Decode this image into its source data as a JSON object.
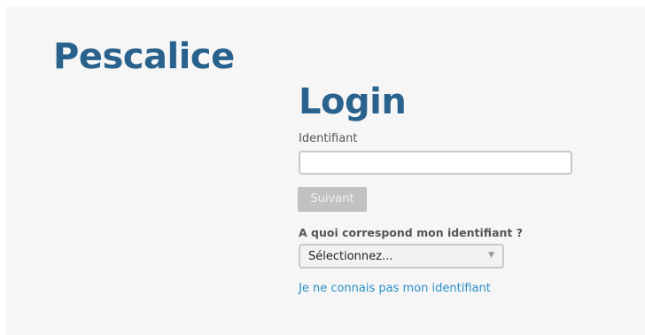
{
  "brand": {
    "name": "Pescalice",
    "color": "#2a628e"
  },
  "login": {
    "title": "Login",
    "identifier_label": "Identifiant",
    "identifier_value": "",
    "next_label": "Suivant",
    "question_label": "A quoi correspond mon identifiant ?",
    "select_value": "Sélectionnez...",
    "select_arrow_icon": "triangle-down-icon",
    "help_link_label": "Je ne connais pas mon identifiant",
    "link_color": "#2a8fc7",
    "disabled_button_color": "#c1c1c1"
  }
}
